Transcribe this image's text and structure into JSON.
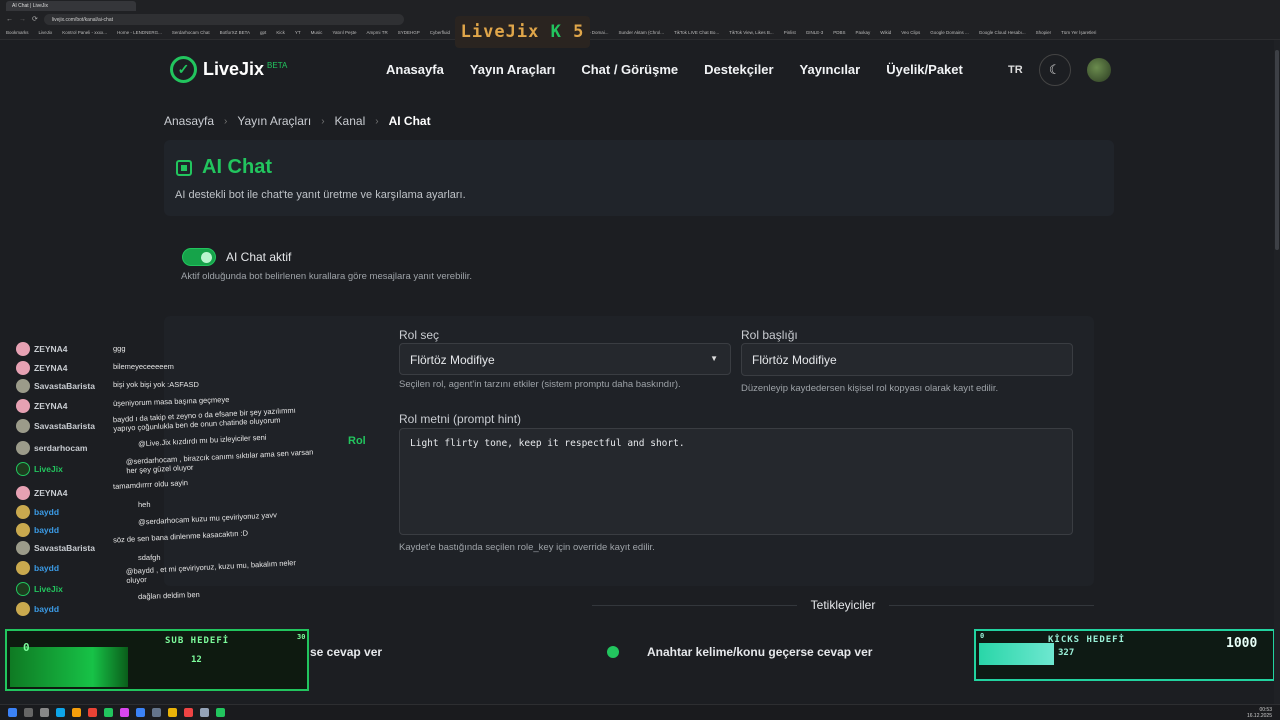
{
  "browser": {
    "tab_title": "AI Chat | LiveJix",
    "url": "livejix.com/bot/kanal/ai-chat",
    "bookmarks": [
      "Bookmarks",
      "LiveJix",
      "Kontrol Paneli - xxxx...",
      "Home - LENDNERG...",
      "Serdarhocam Chat",
      "BotforXZ BETA",
      "gpt",
      "Kick",
      "YT",
      "Music",
      "Yatırıl Peşte",
      "Ampmi TR",
      "SYDEHGP",
      "Cyberfluid",
      "Capcutun bir testi...",
      "Contract, Testreel.en...",
      "Squarespace Domai...",
      "Sunder Aktam (Chrol...",
      "TikTok LIVE Chat Bo...",
      "TikTok View, Likes B...",
      "Pinlist",
      "GINLE-3",
      "PDBS",
      "Paxkay",
      "Wikid",
      "Veo Clips",
      "Google Domains ...",
      "Google Cloud Hesabı...",
      "Shopier",
      "Tüm Yer İşaretleri"
    ]
  },
  "overlay": {
    "logo_left": "LiveJix",
    "logo_k": "K",
    "logo_right": "5"
  },
  "nav": {
    "brand": "LiveJix",
    "brand_badge": "BETA",
    "links": [
      "Anasayfa",
      "Yayın Araçları",
      "Chat / Görüşme",
      "Destekçiler",
      "Yayıncılar",
      "Üyelik/Paket"
    ],
    "lang": "TR"
  },
  "breadcrumb": {
    "items": [
      "Anasayfa",
      "Yayın Araçları",
      "Kanal"
    ],
    "current": "AI Chat"
  },
  "page": {
    "title": "AI Chat",
    "subtitle": "AI destekli bot ile chat'te yanıt üretme ve karşılama ayarları."
  },
  "toggle": {
    "label": "AI Chat aktif",
    "description": "Aktif olduğunda bot belirlenen kurallara göre mesajlara yanıt verebilir.",
    "enabled": true
  },
  "role": {
    "section_label": "Rol",
    "select_label": "Rol seç",
    "select_value": "Flörtöz Modifiye",
    "select_help": "Seçilen rol, agent'in tarzını etkiler (sistem promptu daha baskındır).",
    "title_label": "Rol başlığı",
    "title_value": "Flörtöz Modifiye",
    "title_help": "Düzenleyip kaydedersen kişisel rol kopyası olarak kayıt edilir.",
    "text_label": "Rol metni (prompt hint)",
    "text_value": "Light flirty tone, keep it respectful and short.",
    "text_help": "Kaydet'e bastığında seçilen role_key için override kayıt edilir."
  },
  "triggers": {
    "title": "Tetikleyiciler",
    "item_left": "se cevap ver",
    "item_right": "Anahtar kelime/konu geçerse cevap ver"
  },
  "chat": [
    {
      "user": "ZEYNA4",
      "msg": "ggg"
    },
    {
      "user": "ZEYNA4",
      "msg": "bilemeyeceeeeem"
    },
    {
      "user": "SavastaBarista",
      "msg": "bişi yok bişi yok :ASFASD"
    },
    {
      "user": "ZEYNA4",
      "msg": "üşeniyorum masa başına geçmeye"
    },
    {
      "user": "SavastaBarista",
      "msg": "baydd ı da takip et zeyno o da efsane bir şey yazılımmı yapıyo çoğunlukla ben de onun chatinde oluyorum"
    },
    {
      "user": "serdarhocam",
      "msg": "@Live.Jix kızdırdı mı bu izleyiciler seni"
    },
    {
      "user": "LiveJix",
      "msg": "@serdarhocam , birazcık canımı sıktılar ama sen varsan her şey güzel oluyor"
    },
    {
      "user": "ZEYNA4",
      "msg": "tamamdırrrr oldu sayin"
    },
    {
      "user": "baydd",
      "msg": "heh"
    },
    {
      "user": "baydd",
      "msg": "@serdarhocam kuzu mu çeviriyonuz yavv"
    },
    {
      "user": "SavastaBarista",
      "msg": "söz de sen bana dinlenme kasacaktın :D"
    },
    {
      "user": "baydd",
      "msg": "sdafgh"
    },
    {
      "user": "LiveJix",
      "msg": "@baydd , et mi çeviriyoruz, kuzu mu, bakalım neler oluyor"
    },
    {
      "user": "baydd",
      "msg": "dağları deldim ben"
    }
  ],
  "goals": {
    "sub_title": "SUB HEDEFİ",
    "sub_start": "0",
    "sub_current": "12",
    "sub_target": "30",
    "sub_progress": 0.4,
    "kicks_title": "KİCKS HEDEFİ",
    "kicks_start": "0",
    "kicks_current": "327",
    "kicks_target": "1000",
    "kicks_progress": 0.327
  },
  "taskbar": {
    "time": "00:53",
    "date": "16.12.2025"
  }
}
